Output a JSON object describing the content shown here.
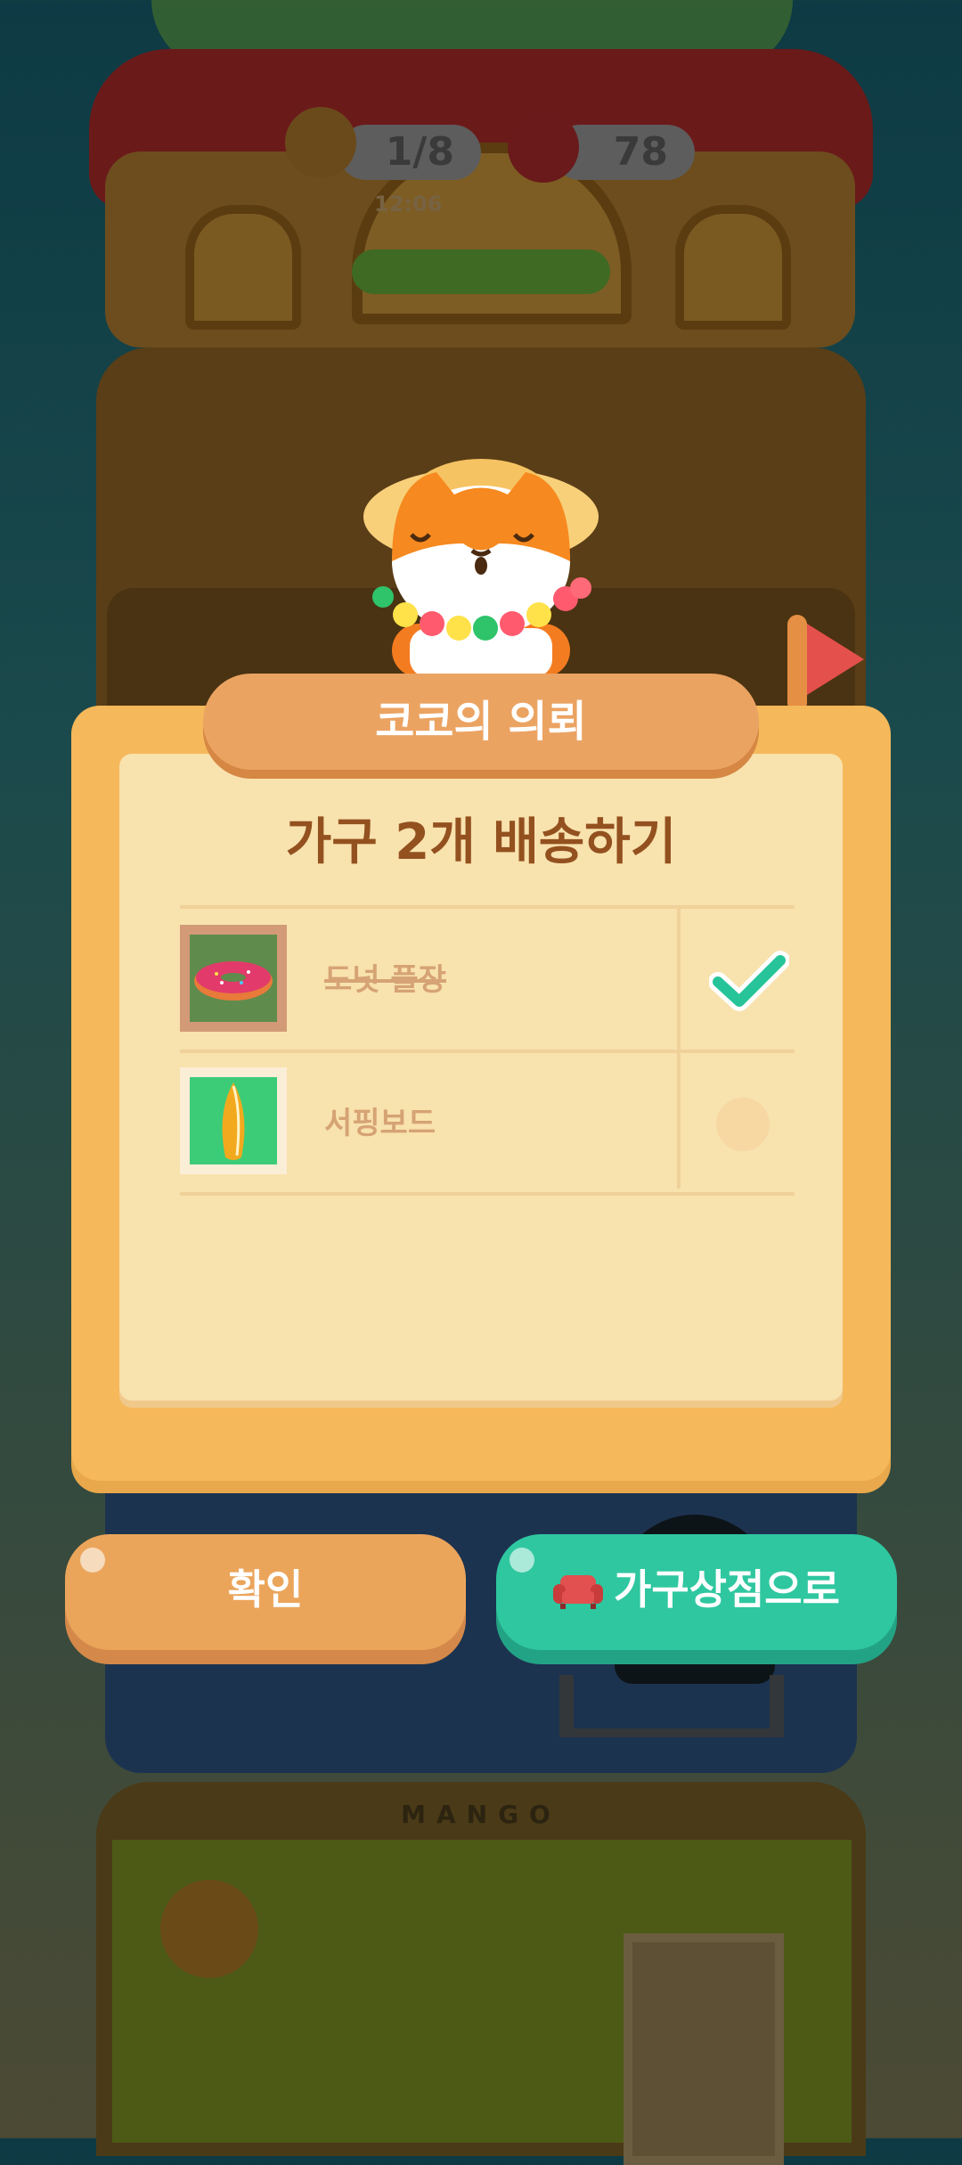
{
  "hud": {
    "jar_count": "1/8",
    "can_count": "78",
    "timer": "12:06"
  },
  "scene": {
    "shop_sign": "MANGO"
  },
  "dialog": {
    "header": "코코의 의뢰",
    "quest_title": "가구 2개 배송하기",
    "items": [
      {
        "name": "도넛 플장",
        "completed": true,
        "thumb_icon": "donut-icon"
      },
      {
        "name": "서핑보드",
        "completed": false,
        "thumb_icon": "surfboard-icon"
      }
    ]
  },
  "buttons": {
    "confirm": "확인",
    "furniture_shop": "가구상점으로",
    "furniture_shop_icon": "sofa-icon"
  },
  "colors": {
    "panel": "#f5b85a",
    "header": "#eba362",
    "confirm_button": "#eba55b",
    "shop_button": "#2fc7a0",
    "check": "#27c49a"
  }
}
